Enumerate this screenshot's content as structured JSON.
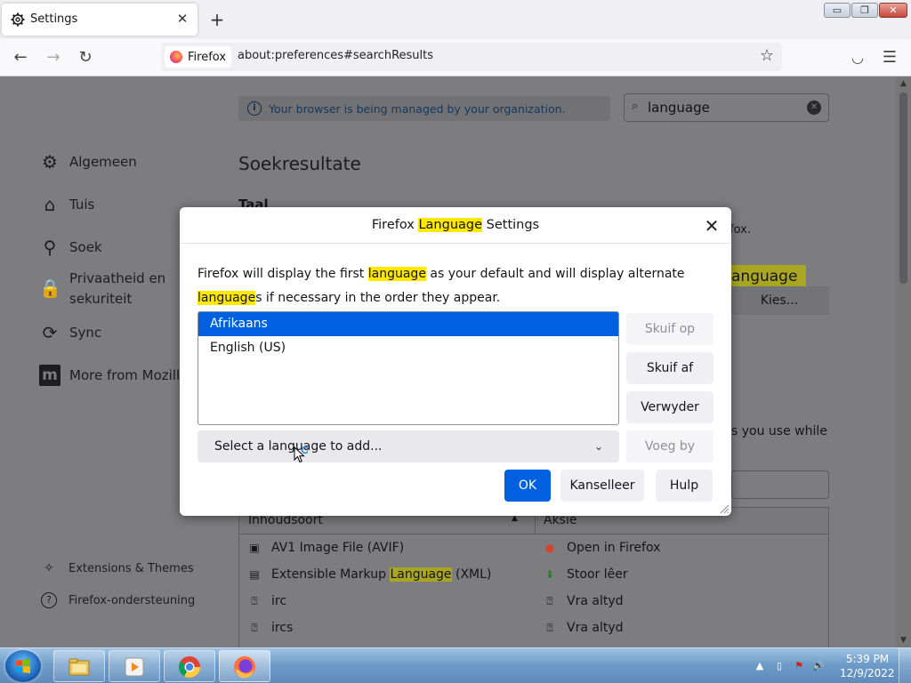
{
  "tab": {
    "title": "Settings",
    "close_glyph": "✕",
    "new_tab_glyph": "+"
  },
  "window_controls": {
    "minimize": "▭",
    "maximize": "❐",
    "close": "✕"
  },
  "urlbar": {
    "identity_label": "Firefox",
    "url": "about:preferences#searchResults"
  },
  "icons": {
    "back": "←",
    "forward": "→",
    "reload": "↻",
    "bookmark": "☆",
    "pocket": "◡",
    "menu": "☰",
    "search": "⌕",
    "clear": "✕",
    "info": "i",
    "chevron_down": "⌄"
  },
  "sidebar": {
    "items": [
      {
        "label": "Algemeen",
        "icon": "⚙"
      },
      {
        "label": "Tuis",
        "icon": "⌂"
      },
      {
        "label": "Soek",
        "icon": "⚲"
      },
      {
        "label_line1": "Privaatheid en",
        "label_line2": "sekuriteit",
        "icon": "🔒"
      },
      {
        "label": "Sync",
        "icon": "⟳"
      },
      {
        "label": "More from Mozilla",
        "icon": "m"
      }
    ],
    "footer": [
      {
        "label": "Extensions & Themes",
        "icon": "✧"
      },
      {
        "label": "Firefox-ondersteuning",
        "icon": "?"
      }
    ]
  },
  "main": {
    "managed_notice": "Your browser is being managed by your organization.",
    "search_value": "language",
    "results_title": "Soekresultate",
    "section_heading": "Taal",
    "bg_suffix_1": "fox.",
    "bg_chip": "anguage",
    "bg_choose_button": "Kies...",
    "bg_suffix_2": "s you use while",
    "table": {
      "col_content": "Inhoudsoort",
      "col_action": "Aksie",
      "sort_glyph": "▲",
      "rows": [
        {
          "content": "AV1 Image File (AVIF)",
          "content_icon": "▣",
          "action": "Open in Firefox",
          "action_icon": "●"
        },
        {
          "content_pre": "Extensible Markup ",
          "content_hl": "Language",
          "content_post": " (XML)",
          "content_icon": "▤",
          "action": "Stoor lêer",
          "action_icon": "⬇"
        },
        {
          "content": "irc",
          "content_icon": "⍰",
          "action": "Vra altyd",
          "action_icon": "⍰"
        },
        {
          "content": "ircs",
          "content_icon": "⍰",
          "action": "Vra altyd",
          "action_icon": "⍰"
        }
      ]
    }
  },
  "dialog": {
    "title_pre": "Firefox ",
    "title_hl": "Language",
    "title_post": " Settings",
    "close_glyph": "✕",
    "desc_a": "Firefox will display the first ",
    "desc_hl1": "language",
    "desc_b": " as your default and will display alternate ",
    "desc_hl2": "language",
    "desc_c": "s if necessary in the order they appear.",
    "languages": [
      {
        "label": "Afrikaans",
        "selected": true
      },
      {
        "label": "English (US)",
        "selected": false
      }
    ],
    "buttons": {
      "move_up": "Skuif op",
      "move_down": "Skuif af",
      "remove": "Verwyder",
      "add": "Voeg by",
      "ok": "OK",
      "cancel": "Kanselleer",
      "help": "Hulp"
    },
    "select_placeholder": "Select a language to add..."
  },
  "taskbar": {
    "clock_time": "5:39 PM",
    "clock_date": "12/9/2022",
    "tray_icons": [
      "▲",
      "▯",
      "⚑",
      "🔊"
    ]
  },
  "colors": {
    "accent": "#0061e0",
    "highlight": "#ffe900",
    "dim_overlay": "#7d7d7f"
  }
}
